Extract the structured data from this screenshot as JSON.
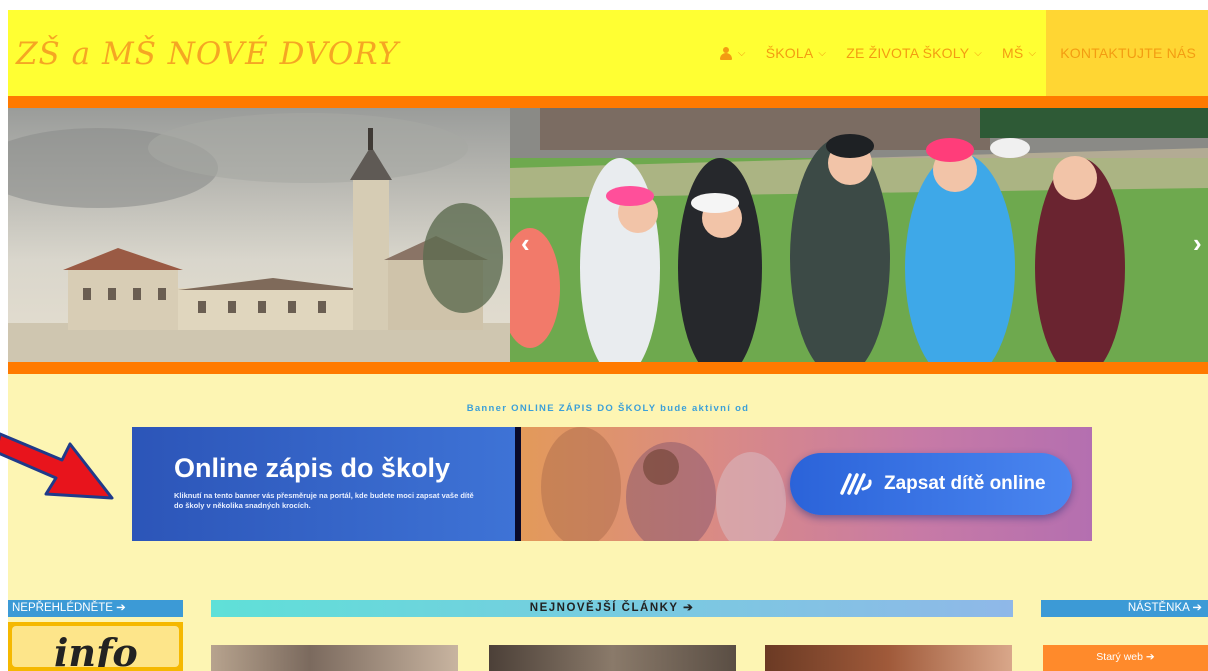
{
  "header": {
    "site_title": "ZŠ a MŠ NOVÉ DVORY",
    "nav": [
      {
        "label": "ŠKOLA"
      },
      {
        "label": "ZE ŽIVOTA ŠKOLY"
      },
      {
        "label": "MŠ"
      },
      {
        "label": "KONTAKTUJTE NÁS"
      }
    ]
  },
  "slider": {
    "prev": "‹",
    "next": "›"
  },
  "banner": {
    "notice": "Banner ONLINE ZÁPIS DO ŠKOLY bude aktivní od",
    "title": "Online zápis do školy",
    "description": "Kliknutí na tento banner vás přesměruje na portál, kde budete moci zapsat vaše dítě do školy v několika snadných krocích.",
    "button_label": "Zapsat dítě online"
  },
  "sections": {
    "nepreh": "NEPŘEHLÉDNĚTE ➔",
    "articles": "NEJNOVĚJŠÍ ČLÁNKY ➔",
    "nastenka": "NÁSTĚNKA ➔"
  },
  "info_image_text": "info",
  "old_web": "Starý web ➔",
  "colors": {
    "header_bg": "#ffff33",
    "accent_orange": "#ff7a00",
    "page_bg": "#fdf5b3",
    "section_blue": "#3c9ad6"
  }
}
